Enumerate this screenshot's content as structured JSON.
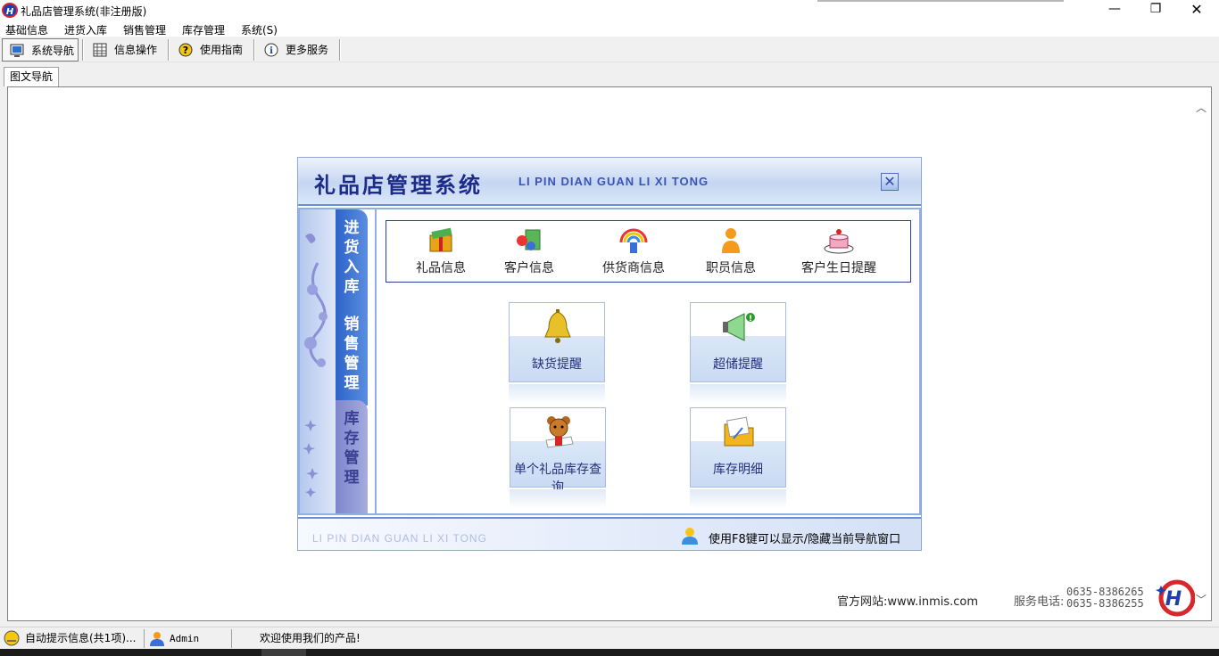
{
  "window": {
    "title": "礼品店管理系统(非注册版)",
    "logo_text": "H",
    "minimize": "—",
    "maximize": "❐",
    "close": "✕"
  },
  "menu": [
    "基础信息",
    "进货入库",
    "销售管理",
    "库存管理",
    "系统(S)"
  ],
  "toolbar": [
    {
      "label": "系统导航",
      "icon": "monitor-icon"
    },
    {
      "label": "信息操作",
      "icon": "grid-icon"
    },
    {
      "label": "使用指南",
      "icon": "help-icon"
    },
    {
      "label": "更多服务",
      "icon": "info-icon"
    }
  ],
  "tab": {
    "label": "图文导航"
  },
  "panel": {
    "title": "礼品店管理系统",
    "subtitle": "LI PIN DIAN GUAN LI XI TONG",
    "close": "✕",
    "side_tabs": [
      "进货入库",
      "销售管理",
      "库存管理"
    ],
    "features": [
      {
        "label": "礼品信息",
        "icon": "gift-icon"
      },
      {
        "label": "客户信息",
        "icon": "customers-icon"
      },
      {
        "label": "供货商信息",
        "icon": "supplier-icon"
      },
      {
        "label": "职员信息",
        "icon": "employee-icon"
      },
      {
        "label": "客户生日提醒",
        "icon": "cake-icon"
      }
    ],
    "big_buttons": [
      {
        "label": "缺货提醒",
        "icon": "bell-icon"
      },
      {
        "label": "超储提醒",
        "icon": "megaphone-icon"
      },
      {
        "label": "单个礼品库存查询",
        "icon": "teddy-bear-icon"
      },
      {
        "label": "库存明细",
        "icon": "folder-icon"
      }
    ],
    "footer_left": "LI PIN DIAN GUAN LI XI TONG",
    "footer_right": "使用F8键可以显示/隐藏当前导航窗口"
  },
  "info": {
    "site": "官方网站:www.inmis.com",
    "phone_label": "服务电话:",
    "phones": [
      "0635-8386265",
      "0635-8386255"
    ]
  },
  "status": {
    "tips": "自动提示信息(共1项)...",
    "user": "Admin",
    "welcome": "欢迎使用我们的产品!"
  },
  "colors": {
    "accent": "#1c2b88",
    "tab_blue": "#2d63c8",
    "tab_purple": "#7d86cc"
  }
}
